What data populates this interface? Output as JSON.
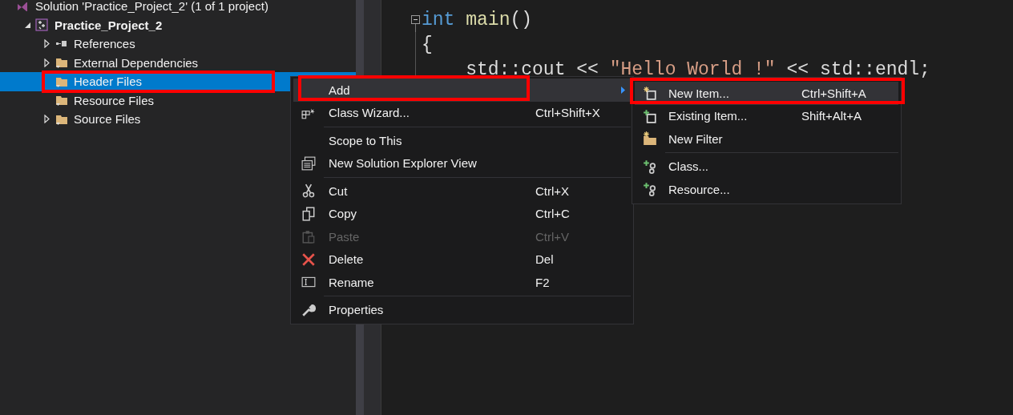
{
  "solution_explorer": {
    "tree": [
      {
        "kind": "solution",
        "label": "Solution 'Practice_Project_2' (1 of 1 project)",
        "selected": false,
        "children": [
          {
            "kind": "project",
            "label": "Practice_Project_2",
            "selected": false,
            "expanded": true,
            "children": [
              {
                "kind": "references",
                "label": "References",
                "selected": false,
                "expanded": false
              },
              {
                "kind": "folder",
                "label": "External Dependencies",
                "selected": false,
                "expanded": false
              },
              {
                "kind": "folder",
                "label": "Header Files",
                "selected": true
              },
              {
                "kind": "folder",
                "label": "Resource Files",
                "selected": false
              },
              {
                "kind": "folder",
                "label": "Source Files",
                "selected": false,
                "expanded": false
              }
            ]
          }
        ]
      }
    ]
  },
  "editor": {
    "lines": [
      {
        "collapsible": true,
        "tokens": [
          {
            "kind": "keyword",
            "text": "int"
          },
          {
            "kind": "function",
            "text": " main"
          },
          {
            "kind": "plain",
            "text": "()"
          }
        ]
      },
      {
        "collapsible": false,
        "tokens": [
          {
            "kind": "plain",
            "text": "{"
          }
        ]
      },
      {
        "collapsible": false,
        "tokens": [
          {
            "kind": "plain",
            "text": "    std::cout << "
          },
          {
            "kind": "string",
            "text": "\"Hello World !\""
          },
          {
            "kind": "plain",
            "text": " << std::endl;"
          }
        ]
      }
    ]
  },
  "context_menu": {
    "items": [
      {
        "kind": "item",
        "label": "Add",
        "selected": true,
        "disabled": false,
        "submenu": true
      },
      {
        "kind": "item",
        "label": "Class Wizard...",
        "shortcut": "Ctrl+Shift+X",
        "selected": false,
        "disabled": false,
        "submenu": false
      },
      {
        "kind": "separator"
      },
      {
        "kind": "item",
        "label": "Scope to This",
        "selected": false,
        "disabled": false,
        "submenu": false
      },
      {
        "kind": "item",
        "label": "New Solution Explorer View",
        "selected": false,
        "disabled": false,
        "submenu": false
      },
      {
        "kind": "separator"
      },
      {
        "kind": "item",
        "label": "Cut",
        "shortcut": "Ctrl+X",
        "selected": false,
        "disabled": false,
        "submenu": false
      },
      {
        "kind": "item",
        "label": "Copy",
        "shortcut": "Ctrl+C",
        "selected": false,
        "disabled": false,
        "submenu": false
      },
      {
        "kind": "item",
        "label": "Paste",
        "shortcut": "Ctrl+V",
        "selected": false,
        "disabled": true,
        "submenu": false
      },
      {
        "kind": "item",
        "label": "Delete",
        "shortcut": "Del",
        "selected": false,
        "disabled": false,
        "submenu": false
      },
      {
        "kind": "item",
        "label": "Rename",
        "shortcut": "F2",
        "selected": false,
        "disabled": false,
        "submenu": false
      },
      {
        "kind": "separator"
      },
      {
        "kind": "item",
        "label": "Properties",
        "selected": false,
        "disabled": false,
        "submenu": false
      }
    ]
  },
  "add_submenu": {
    "items": [
      {
        "kind": "item",
        "label": "New Item...",
        "shortcut": "Ctrl+Shift+A",
        "selected": true,
        "disabled": false,
        "submenu": false
      },
      {
        "kind": "item",
        "label": "Existing Item...",
        "shortcut": "Shift+Alt+A",
        "selected": false,
        "disabled": false,
        "submenu": false
      },
      {
        "kind": "item",
        "label": "New Filter",
        "selected": false,
        "disabled": false,
        "submenu": false
      },
      {
        "kind": "separator"
      },
      {
        "kind": "item",
        "label": "Class...",
        "selected": false,
        "disabled": false,
        "submenu": false
      },
      {
        "kind": "item",
        "label": "Resource...",
        "selected": false,
        "disabled": false,
        "submenu": false
      }
    ]
  }
}
